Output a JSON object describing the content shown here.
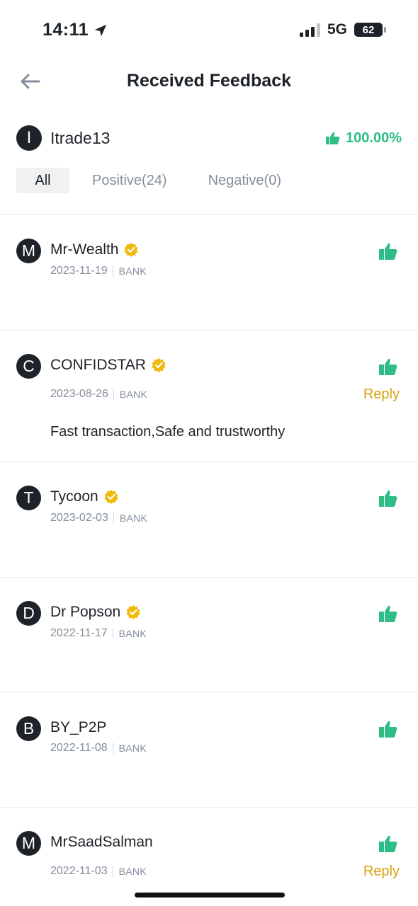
{
  "status_bar": {
    "time": "14:11",
    "network": "5G",
    "battery": "62"
  },
  "header": {
    "title": "Received Feedback"
  },
  "profile": {
    "initial": "I",
    "name": "Itrade13",
    "rate": "100.00%"
  },
  "tabs": [
    {
      "label": "All"
    },
    {
      "label": "Positive(24)"
    },
    {
      "label": "Negative(0)"
    }
  ],
  "feedback": [
    {
      "initial": "M",
      "name": "Mr-Wealth",
      "verified": true,
      "date": "2023-11-19",
      "method": "BANK"
    },
    {
      "initial": "C",
      "name": "CONFIDSTAR",
      "verified": true,
      "date": "2023-08-26",
      "method": "BANK",
      "reply": "Reply",
      "comment": "Fast transaction,Safe and trustworthy"
    },
    {
      "initial": "T",
      "name": "Tycoon",
      "verified": true,
      "date": "2023-02-03",
      "method": "BANK"
    },
    {
      "initial": "D",
      "name": "Dr Popson",
      "verified": true,
      "date": "2022-11-17",
      "method": "BANK"
    },
    {
      "initial": "B",
      "name": "BY_P2P",
      "verified": false,
      "date": "2022-11-08",
      "method": "BANK"
    },
    {
      "initial": "M",
      "name": "MrSaadSalman",
      "verified": false,
      "date": "2022-11-03",
      "method": "BANK",
      "reply": "Reply"
    }
  ],
  "colors": {
    "positive": "#2ebd85",
    "reply": "#d9a10d",
    "verified_badge": "#f0b90b"
  }
}
